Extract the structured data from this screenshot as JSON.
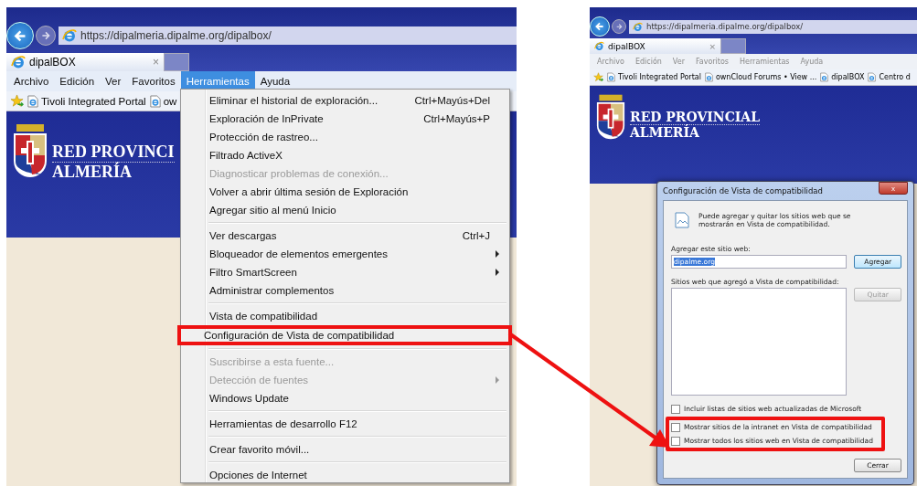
{
  "left_screen": {
    "url": "https://dipalmeria.dipalme.org/dipalbox/",
    "tab": {
      "title": "dipalBOX",
      "close": "×"
    },
    "menu_bar": [
      {
        "label": "Archivo",
        "selected": false
      },
      {
        "label": "Edición",
        "selected": false
      },
      {
        "label": "Ver",
        "selected": false
      },
      {
        "label": "Favoritos",
        "selected": false
      },
      {
        "label": "Herramientas",
        "selected": true
      },
      {
        "label": "Ayuda",
        "selected": false
      }
    ],
    "favorites": [
      "Tivoli Integrated Portal",
      "ow"
    ],
    "banner": {
      "line_1": "RED PROVINCI",
      "line_2": "ALMERÍA"
    },
    "tools_menu": [
      [
        {
          "label": "Eliminar el historial de exploración...",
          "shortcut": "Ctrl+Mayús+Del",
          "disabled": false,
          "submenu": false,
          "highlighted": false
        },
        {
          "label": "Exploración de InPrivate",
          "shortcut": "Ctrl+Mayús+P",
          "disabled": false,
          "submenu": false,
          "highlighted": false
        },
        {
          "label": "Protección de rastreo...",
          "disabled": false,
          "submenu": false,
          "highlighted": false
        },
        {
          "label": "Filtrado ActiveX",
          "disabled": false,
          "submenu": false,
          "highlighted": false
        },
        {
          "label": "Diagnosticar problemas de conexión...",
          "disabled": true,
          "submenu": false,
          "highlighted": false
        },
        {
          "label": "Volver a abrir última sesión de Exploración",
          "disabled": false,
          "submenu": false,
          "highlighted": false
        },
        {
          "label": "Agregar sitio al menú Inicio",
          "disabled": false,
          "submenu": false,
          "highlighted": false
        }
      ],
      [
        {
          "label": "Ver descargas",
          "shortcut": "Ctrl+J",
          "disabled": false,
          "submenu": false,
          "highlighted": false
        },
        {
          "label": "Bloqueador de elementos emergentes",
          "disabled": false,
          "submenu": true,
          "highlighted": false
        },
        {
          "label": "Filtro SmartScreen",
          "disabled": false,
          "submenu": true,
          "highlighted": false
        },
        {
          "label": "Administrar complementos",
          "disabled": false,
          "submenu": false,
          "highlighted": false
        }
      ],
      [
        {
          "label": "Vista de compatibilidad",
          "disabled": false,
          "submenu": false,
          "highlighted": false
        },
        {
          "label": "Configuración de Vista de compatibilidad",
          "disabled": false,
          "submenu": false,
          "highlighted": true
        }
      ],
      [
        {
          "label": "Suscribirse a esta fuente...",
          "disabled": true,
          "submenu": false,
          "highlighted": false
        },
        {
          "label": "Detección de fuentes",
          "disabled": true,
          "submenu": true,
          "highlighted": false
        },
        {
          "label": "Windows Update",
          "disabled": false,
          "submenu": false,
          "highlighted": false
        }
      ],
      [
        {
          "label": "Herramientas de desarrollo F12",
          "disabled": false,
          "submenu": false,
          "highlighted": false
        }
      ],
      [
        {
          "label": "Crear favorito móvil...",
          "disabled": false,
          "submenu": false,
          "highlighted": false
        }
      ],
      [
        {
          "label": "Opciones de Internet",
          "disabled": false,
          "submenu": false,
          "highlighted": false
        }
      ]
    ]
  },
  "right_screen": {
    "url": "https://dipalmeria.dipalme.org/dipalbox/",
    "tab": {
      "title": "dipalBOX",
      "close": "×"
    },
    "menu_bar": [
      {
        "label": "Archivo",
        "disabled": true
      },
      {
        "label": "Edición",
        "disabled": true
      },
      {
        "label": "Ver",
        "disabled": true
      },
      {
        "label": "Favoritos",
        "disabled": true
      },
      {
        "label": "Herramientas",
        "disabled": true
      },
      {
        "label": "Ayuda",
        "disabled": true
      }
    ],
    "favorites": [
      "Tivoli Integrated Portal",
      "ownCloud Forums • View ...",
      "dipalBOX",
      "Centro d"
    ],
    "banner": {
      "line_1": "RED PROVINCIAL",
      "line_2": "ALMERÍA"
    },
    "dialog": {
      "title": "Configuración de Vista de compatibilidad",
      "close": "x",
      "intro": "Puede agregar y quitar los sitios web que se mostrarán en Vista de compatibilidad.",
      "add_label": "Agregar este sitio web:",
      "add_value": "dipalme.org",
      "add_button": "Agregar",
      "list_label": "Sitios web que agregó a Vista de compatibilidad:",
      "remove_button": {
        "label": "Quitar",
        "disabled": true
      },
      "options": [
        {
          "label": "Incluir listas de sitios web actualizadas de Microsoft",
          "checked": false,
          "highlighted": false
        },
        {
          "label": "Mostrar sitios de la intranet en Vista de compatibilidad",
          "checked": false,
          "highlighted": true
        },
        {
          "label": "Mostrar todos los sitios web en Vista de compatibilidad",
          "checked": false,
          "highlighted": true
        }
      ],
      "close_button": "Cerrar"
    }
  }
}
